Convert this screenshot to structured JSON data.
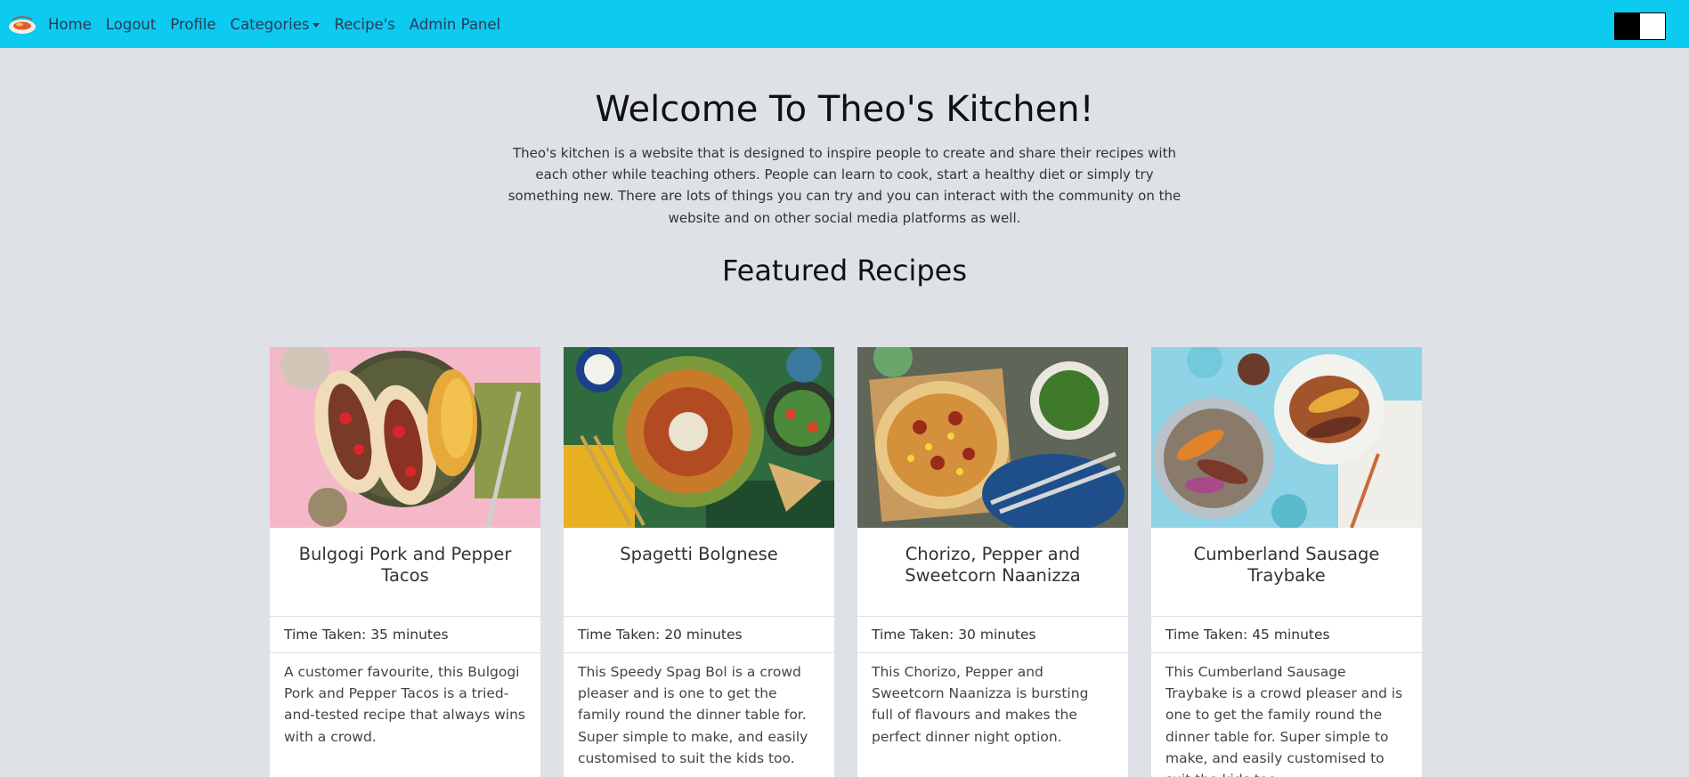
{
  "nav": {
    "items": {
      "home": "Home",
      "logout": "Logout",
      "profile": "Profile",
      "categories": "Categories",
      "recipes": "Recipe's",
      "admin": "Admin Panel"
    }
  },
  "hero": {
    "title": "Welcome To Theo's Kitchen!",
    "description": "Theo's kitchen is a website that is designed to inspire people to create and share their recipes with each other while teaching others. People can learn to cook, start a healthy diet or simply try something new. There are lots of things you can try and you can interact with the community on the website and on other social media platforms as well."
  },
  "featured": {
    "title": "Featured Recipes"
  },
  "cards": [
    {
      "title": "Bulgogi Pork and Pepper Tacos",
      "time": "Time Taken: 35 minutes",
      "description": "A customer favourite, this Bulgogi Pork and Pepper Tacos is a tried-and-tested recipe that always wins with a crowd."
    },
    {
      "title": "Spagetti Bolgnese",
      "time": "Time Taken: 20 minutes",
      "description": "This Speedy Spag Bol is a crowd pleaser and is one to get the family round the dinner table for. Super simple to make, and easily customised to suit the kids too."
    },
    {
      "title": "Chorizo, Pepper and Sweetcorn Naanizza",
      "time": "Time Taken: 30 minutes",
      "description": "This Chorizo, Pepper and Sweetcorn Naanizza is bursting full of flavours and makes the perfect dinner night option."
    },
    {
      "title": "Cumberland Sausage Traybake",
      "time": "Time Taken: 45 minutes",
      "description": "This Cumberland Sausage Traybake is a crowd pleaser and is one to get the family round the dinner table for. Super simple to make, and easily customised to suit the kids too."
    }
  ]
}
